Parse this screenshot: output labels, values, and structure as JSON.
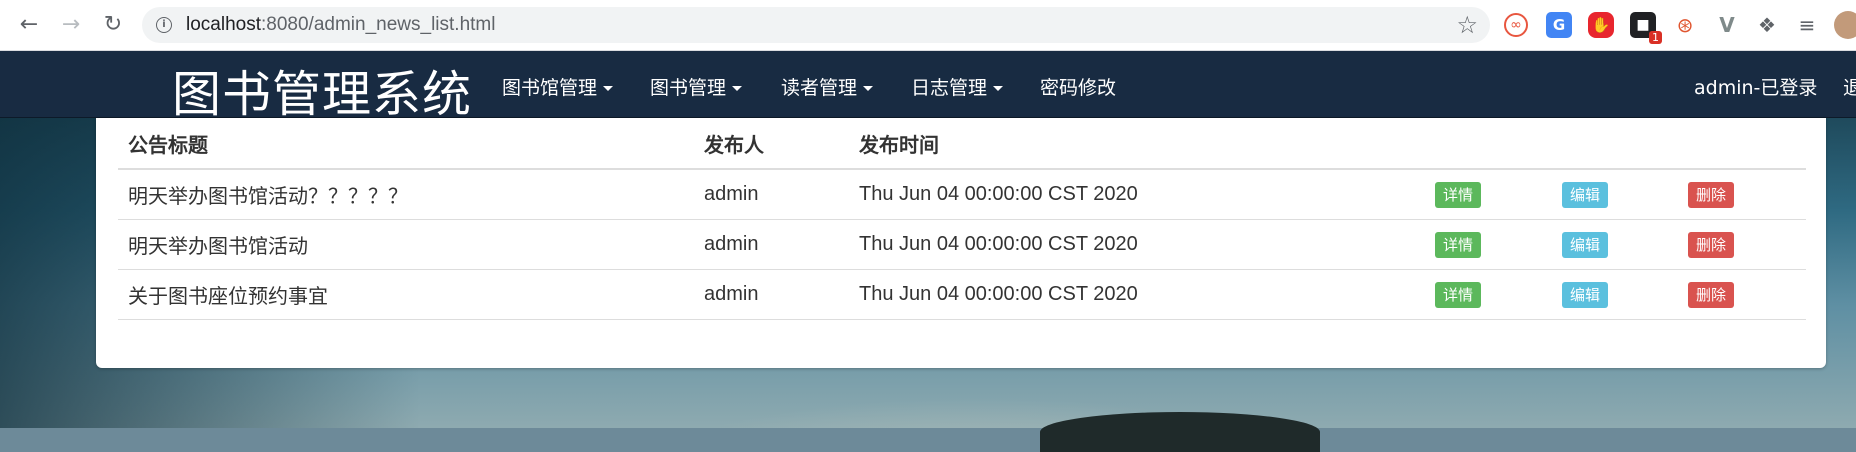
{
  "browser": {
    "url_host": "localhost",
    "url_path": ":8080/admin_news_list.html",
    "extensions": [
      {
        "icon": "infinity-extension-icon",
        "color": "#e8563f"
      },
      {
        "icon": "google-translate-icon",
        "color": "#4285f4"
      },
      {
        "icon": "adblock-stop-icon",
        "color": "#e8262e"
      },
      {
        "icon": "notification-extension-icon",
        "color": "#202124",
        "badge": "1"
      },
      {
        "icon": "network-extension-icon",
        "color": "#e0552f"
      },
      {
        "icon": "vue-devtools-icon",
        "color": "#7f8a8a"
      },
      {
        "icon": "puzzle-extensions-icon",
        "color": "#5f6368"
      },
      {
        "icon": "reading-list-icon",
        "color": "#5f6368"
      },
      {
        "icon": "profile-avatar-icon",
        "color": "#c29a7a"
      }
    ]
  },
  "navbar": {
    "brand": "图书管理系统",
    "menus": [
      {
        "label": "图书馆管理",
        "dropdown": true
      },
      {
        "label": "图书管理",
        "dropdown": true
      },
      {
        "label": "读者管理",
        "dropdown": true
      },
      {
        "label": "日志管理",
        "dropdown": true
      },
      {
        "label": "密码修改",
        "dropdown": false
      }
    ],
    "user_status": "admin-已登录",
    "logout_partial": "退"
  },
  "table": {
    "headers": [
      "公告标题",
      "发布人",
      "发布时间"
    ],
    "rows": [
      {
        "title": "明天举办图书馆活动？？？？？",
        "author": "admin",
        "time": "Thu Jun 04 00:00:00 CST 2020"
      },
      {
        "title": "明天举办图书馆活动",
        "author": "admin",
        "time": "Thu Jun 04 00:00:00 CST 2020"
      },
      {
        "title": "关于图书座位预约事宜",
        "author": "admin",
        "time": "Thu Jun 04 00:00:00 CST 2020"
      }
    ],
    "actions": {
      "detail": "详情",
      "edit": "编辑",
      "delete": "删除"
    }
  }
}
